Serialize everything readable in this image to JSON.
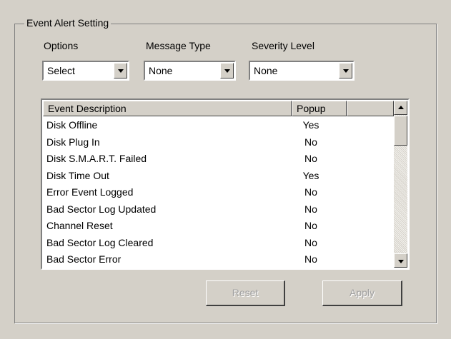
{
  "group": {
    "title": "Event Alert Setting"
  },
  "options": {
    "label": "Options",
    "value": "Select"
  },
  "message_type": {
    "label": "Message Type",
    "value": "None"
  },
  "severity_level": {
    "label": "Severity Level",
    "value": "None"
  },
  "table": {
    "columns": [
      "Event Description",
      "Popup"
    ],
    "rows": [
      {
        "description": "Disk Offline",
        "popup": "Yes"
      },
      {
        "description": "Disk Plug In",
        "popup": "No"
      },
      {
        "description": "Disk S.M.A.R.T. Failed",
        "popup": "No"
      },
      {
        "description": "Disk Time Out",
        "popup": "Yes"
      },
      {
        "description": "Error Event Logged",
        "popup": "No"
      },
      {
        "description": "Bad Sector Log Updated",
        "popup": "No"
      },
      {
        "description": "Channel Reset",
        "popup": "No"
      },
      {
        "description": "Bad Sector Log Cleared",
        "popup": "No"
      },
      {
        "description": "Bad Sector Error",
        "popup": "No"
      }
    ]
  },
  "buttons": {
    "reset": "Reset",
    "apply": "Apply"
  },
  "icons": {
    "combo_arrow": "chevron-down-icon",
    "scroll_up": "scroll-up-arrow-icon",
    "scroll_down": "scroll-down-arrow-icon"
  },
  "colors": {
    "face": "#d4d0c8",
    "disabled_text": "#a0a0a0",
    "list_bg": "#ffffff"
  }
}
